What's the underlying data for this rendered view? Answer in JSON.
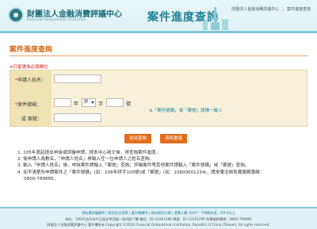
{
  "header": {
    "logo_cn": "財團法人金融消費評議中心",
    "logo_en": "Financial Ombudsman Institution",
    "title": "案件進度查詢",
    "links": [
      "財團法人金融消費評議中心",
      "案件進度查詢"
    ]
  },
  "section": {
    "title": "案件進度查詢",
    "required_note": "※打星號為必填欄位"
  },
  "form": {
    "applicant_star": "*",
    "applicant_label": "申請人姓名：",
    "applicant_value": "",
    "case_star": "*",
    "case_label": "案件號碼：",
    "year_value": "",
    "year_unit": "年",
    "type_selected": "評",
    "type_unit": "字",
    "number_value": "",
    "number_unit": "號",
    "case_note": "※「案件號碼」或「案號」請擇一輸入",
    "docket_label": "或 案號：",
    "docket_value": ""
  },
  "buttons": {
    "submit": "送出查詢",
    "clear": "清除重填"
  },
  "instructions": [
    "1. 105年度起提出申訴或評議申請，經本中心收文後，得查詢案件進度。",
    "2. 倘申請人為數名，「申請人姓名」再輸入任一位申請人之姓名查詢。",
    "3. 輸入「申請人姓名」後，申訴案件請輸入「案號」查詢；評議案件等其他案件請輸入「案件號碼」或「案號」查詢。",
    "4. 如不清楚所申請案件之「案件號碼」(如：106年評字100號)或「案號」(如：10600001234)，請來電洽詢免費服務專線：",
    "0800-789885。"
  ],
  "footer": {
    "links": "隱私權保護聲明 | 資訊安全政策 | 著作權聲明 | 政府資訊公開 | 瀏覽人數 1024 * 768解析度，IE9.0以上",
    "address": "地址：10041台北市中正區忠孝西路一段4號17樓  電話：02-23161288  傳真：02-23161299  免費服務專線：0800-789885",
    "copyright": "財團法人金融消費評議中心 著作權所有 Copyright ©2016 Financial Ombudsman Institution, Republic of China (Taiwan). All rights reserved."
  }
}
